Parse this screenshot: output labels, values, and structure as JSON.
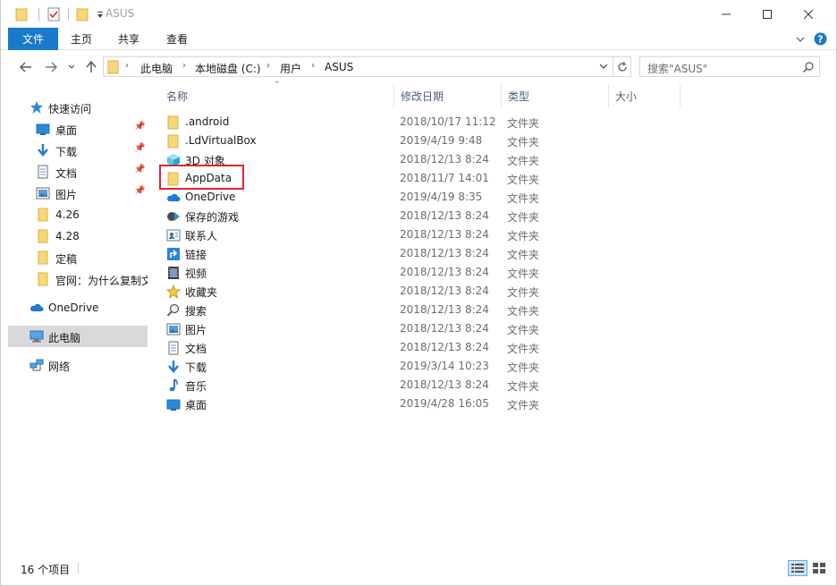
{
  "window": {
    "title": "ASUS",
    "controls": {
      "minimize": "—",
      "maximize": "☐",
      "close": "✕"
    }
  },
  "ribbon": {
    "tabs": [
      "文件",
      "主页",
      "共享",
      "查看"
    ]
  },
  "address": {
    "crumbs": [
      "此电脑",
      "本地磁盘 (C:)",
      "用户",
      "ASUS"
    ],
    "search_placeholder": "搜索\"ASUS\""
  },
  "nav": {
    "quick_access": "快速访问",
    "items": [
      {
        "label": "桌面",
        "icon": "desktop-icon",
        "pinned": true
      },
      {
        "label": "下载",
        "icon": "download-icon",
        "pinned": true
      },
      {
        "label": "文档",
        "icon": "document-icon",
        "pinned": true
      },
      {
        "label": "图片",
        "icon": "picture-icon",
        "pinned": true
      },
      {
        "label": "4.26",
        "icon": "folder-icon",
        "pinned": false
      },
      {
        "label": "4.28",
        "icon": "folder-icon",
        "pinned": false
      },
      {
        "label": "定稿",
        "icon": "folder-icon",
        "pinned": false
      },
      {
        "label": "官网：为什么复制文",
        "icon": "folder-icon",
        "pinned": false
      }
    ],
    "onedrive": "OneDrive",
    "this_pc": "此电脑",
    "network": "网络"
  },
  "columns": {
    "name": "名称",
    "date": "修改日期",
    "type": "类型",
    "size": "大小"
  },
  "files": [
    {
      "name": ".android",
      "date": "2018/10/17 11:12",
      "type": "文件夹",
      "icon": "folder-icon"
    },
    {
      "name": ".LdVirtualBox",
      "date": "2019/4/19 9:48",
      "type": "文件夹",
      "icon": "folder-icon"
    },
    {
      "name": "3D 对象",
      "date": "2018/12/13 8:24",
      "type": "文件夹",
      "icon": "3d-objects-icon"
    },
    {
      "name": "AppData",
      "date": "2018/11/7 14:01",
      "type": "文件夹",
      "icon": "folder-icon"
    },
    {
      "name": "OneDrive",
      "date": "2019/4/19 8:35",
      "type": "文件夹",
      "icon": "onedrive-icon"
    },
    {
      "name": "保存的游戏",
      "date": "2018/12/13 8:24",
      "type": "文件夹",
      "icon": "saved-games-icon"
    },
    {
      "name": "联系人",
      "date": "2018/12/13 8:24",
      "type": "文件夹",
      "icon": "contacts-icon"
    },
    {
      "name": "链接",
      "date": "2018/12/13 8:24",
      "type": "文件夹",
      "icon": "links-icon"
    },
    {
      "name": "视频",
      "date": "2018/12/13 8:24",
      "type": "文件夹",
      "icon": "videos-icon"
    },
    {
      "name": "收藏夹",
      "date": "2018/12/13 8:24",
      "type": "文件夹",
      "icon": "favorites-icon"
    },
    {
      "name": "搜索",
      "date": "2018/12/13 8:24",
      "type": "文件夹",
      "icon": "searches-icon"
    },
    {
      "name": "图片",
      "date": "2018/12/13 8:24",
      "type": "文件夹",
      "icon": "picture-icon"
    },
    {
      "name": "文档",
      "date": "2018/12/13 8:24",
      "type": "文件夹",
      "icon": "document-icon"
    },
    {
      "name": "下载",
      "date": "2019/3/14 10:23",
      "type": "文件夹",
      "icon": "download-icon"
    },
    {
      "name": "音乐",
      "date": "2018/12/13 8:24",
      "type": "文件夹",
      "icon": "music-icon"
    },
    {
      "name": "桌面",
      "date": "2019/4/28 16:05",
      "type": "文件夹",
      "icon": "desktop-icon"
    }
  ],
  "status": {
    "item_count": "16 个项目"
  },
  "colors": {
    "file_tab": "#1979ca",
    "folder": "#f8d775",
    "highlight": "#e0262c",
    "selected_nav": "#d9d9d9"
  }
}
